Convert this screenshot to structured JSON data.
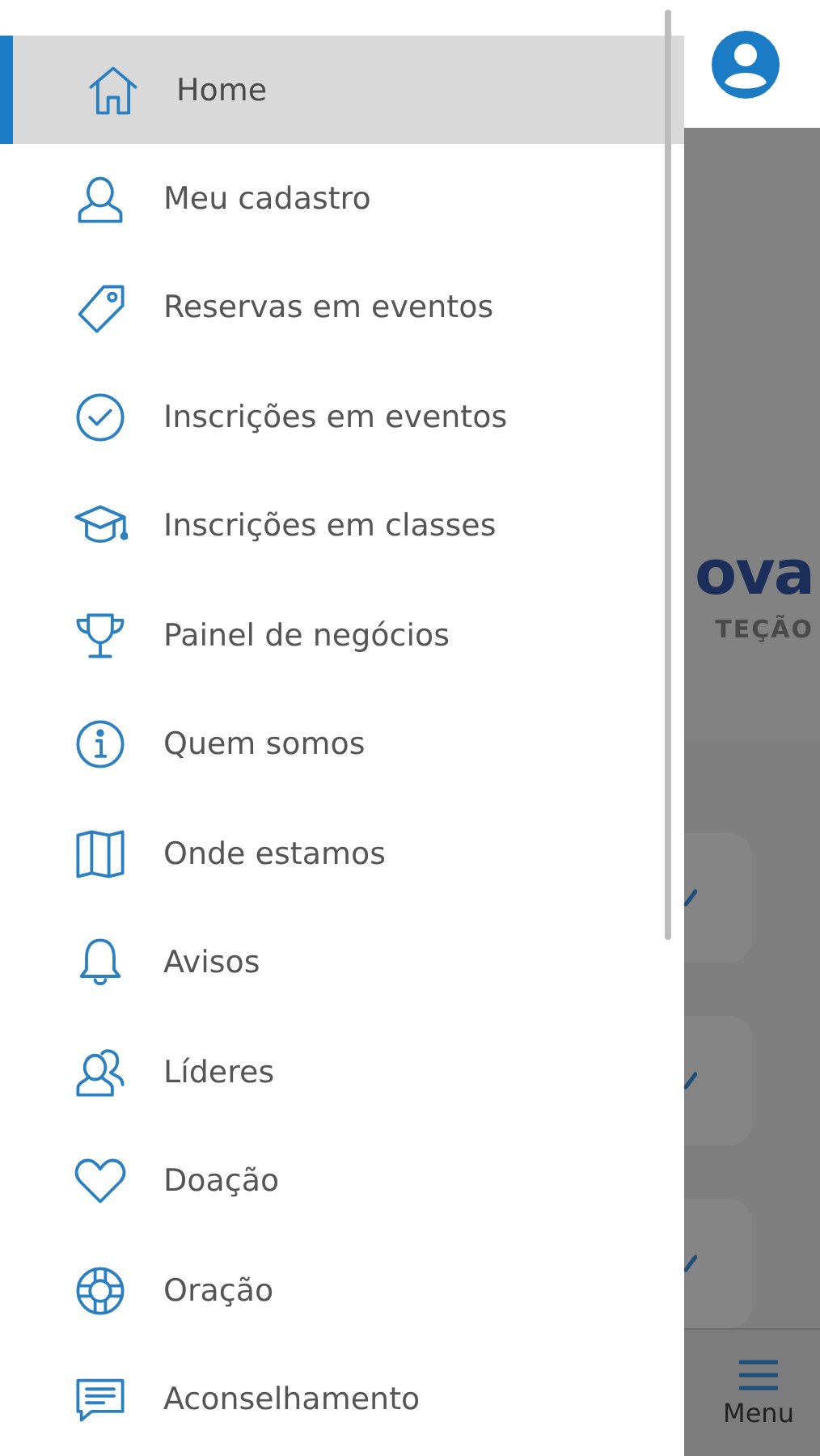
{
  "menu": {
    "items": [
      {
        "label": "Home",
        "selected": true
      },
      {
        "label": "Meu cadastro",
        "selected": false
      },
      {
        "label": "Reservas em eventos",
        "selected": false
      },
      {
        "label": "Inscrições em eventos",
        "selected": false
      },
      {
        "label": "Inscrições em classes",
        "selected": false
      },
      {
        "label": "Painel de negócios",
        "selected": false
      },
      {
        "label": "Quem somos",
        "selected": false
      },
      {
        "label": "Onde estamos",
        "selected": false
      },
      {
        "label": "Avisos",
        "selected": false
      },
      {
        "label": "Líderes",
        "selected": false
      },
      {
        "label": "Doação",
        "selected": false
      },
      {
        "label": "Oração",
        "selected": false
      },
      {
        "label": "Aconselhamento",
        "selected": false
      }
    ]
  },
  "background": {
    "logo_text": "ova",
    "logo_subtitle": "TEÇÃO",
    "tab_bar": {
      "label": "Menu"
    }
  }
}
